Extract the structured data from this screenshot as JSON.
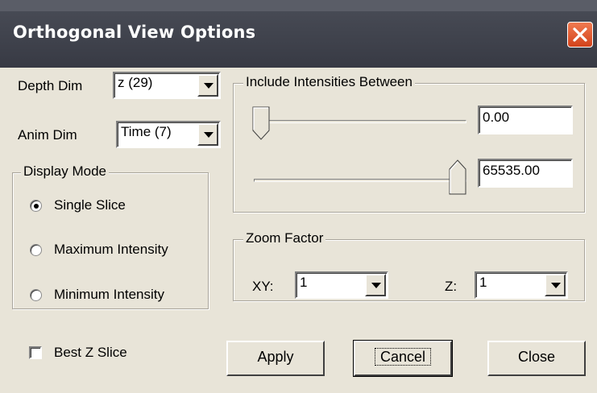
{
  "window": {
    "title": "Orthogonal View Options"
  },
  "depth_dim": {
    "label": "Depth Dim",
    "value": "z (29)"
  },
  "anim_dim": {
    "label": "Anim Dim",
    "value": "Time (7)"
  },
  "display_mode": {
    "legend": "Display Mode",
    "options": [
      {
        "label": "Single Slice",
        "selected": true
      },
      {
        "label": "Maximum Intensity",
        "selected": false
      },
      {
        "label": "Minimum Intensity",
        "selected": false
      }
    ]
  },
  "intensities": {
    "legend": "Include Intensities Between",
    "min_value": "0.00",
    "max_value": "65535.00",
    "min_fraction": 0.0,
    "max_fraction": 1.0
  },
  "zoom": {
    "legend": "Zoom Factor",
    "xy_label": "XY:",
    "xy_value": "1",
    "z_label": "Z:",
    "z_value": "1"
  },
  "best_z": {
    "label": "Best Z Slice",
    "checked": false
  },
  "buttons": {
    "apply": "Apply",
    "cancel": "Cancel",
    "close": "Close"
  },
  "colors": {
    "titlebar": "#3f424c",
    "close_button": "#e0552d",
    "dialog_bg": "#e8e4d8"
  }
}
